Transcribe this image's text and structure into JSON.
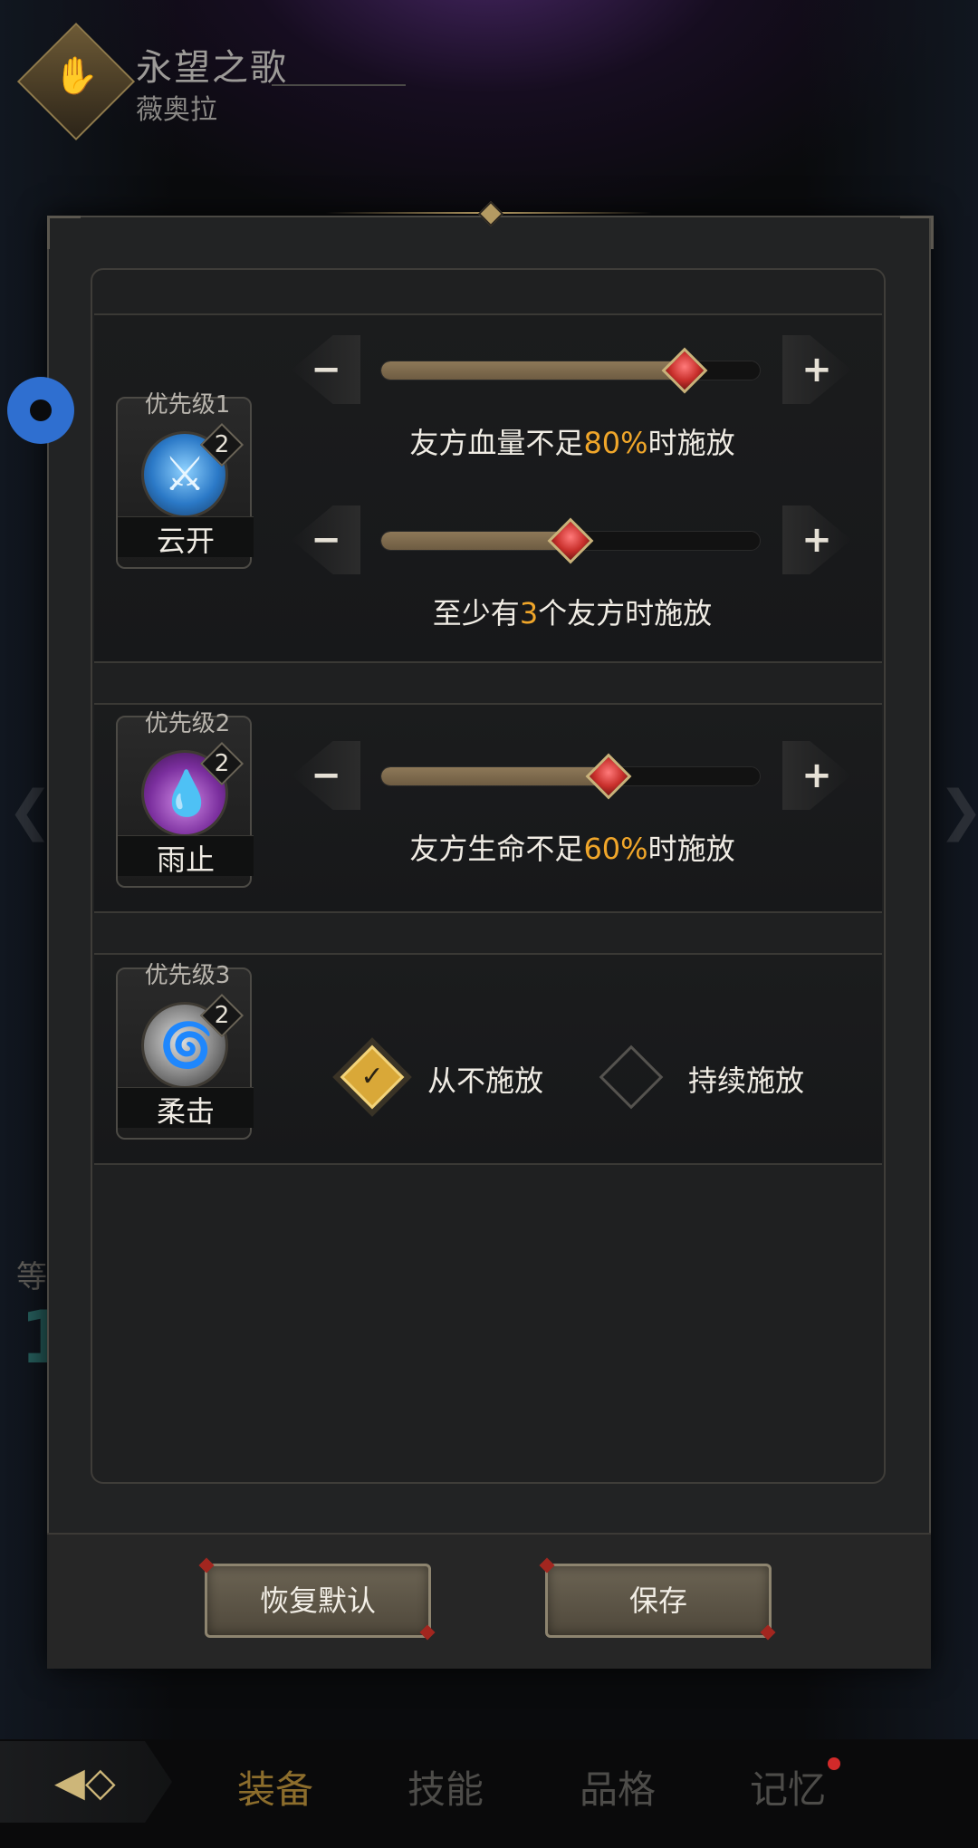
{
  "header": {
    "title": "永望之歌",
    "subtitle": "薇奥拉",
    "emblem_icon": "palm-emblem-icon"
  },
  "background": {
    "level_label": "等",
    "level_value": "1"
  },
  "skills": [
    {
      "priority_label": "优先级1",
      "name": "云开",
      "level": "2",
      "icon": "sword-skill-icon",
      "conditions": [
        {
          "prefix": "友方血量不足",
          "value": "80%",
          "suffix": "时施放",
          "fraction": 0.8
        },
        {
          "prefix": "至少有",
          "value": "3",
          "suffix": "个友方时施放",
          "fraction": 0.5
        }
      ]
    },
    {
      "priority_label": "优先级2",
      "name": "雨止",
      "level": "2",
      "icon": "droplets-skill-icon",
      "conditions": [
        {
          "prefix": "友方生命不足",
          "value": "60%",
          "suffix": "时施放",
          "fraction": 0.6
        }
      ]
    },
    {
      "priority_label": "优先级3",
      "name": "柔击",
      "level": "2",
      "icon": "whirlwind-skill-icon",
      "options": [
        {
          "label": "从不施放",
          "checked": true
        },
        {
          "label": "持续施放",
          "checked": false
        }
      ]
    }
  ],
  "slider_controls": {
    "minus": "−",
    "plus": "+"
  },
  "buttons": {
    "reset": "恢复默认",
    "save": "保存"
  },
  "nav": {
    "back_icon": "diamond-back-icon",
    "tabs": [
      {
        "label": "装备",
        "active": true
      },
      {
        "label": "技能",
        "active": false
      },
      {
        "label": "品格",
        "active": false
      },
      {
        "label": "记忆",
        "active": false,
        "badge": true
      }
    ]
  },
  "colors": {
    "highlight": "#f0a62a",
    "accent_gold": "#cdb679"
  }
}
